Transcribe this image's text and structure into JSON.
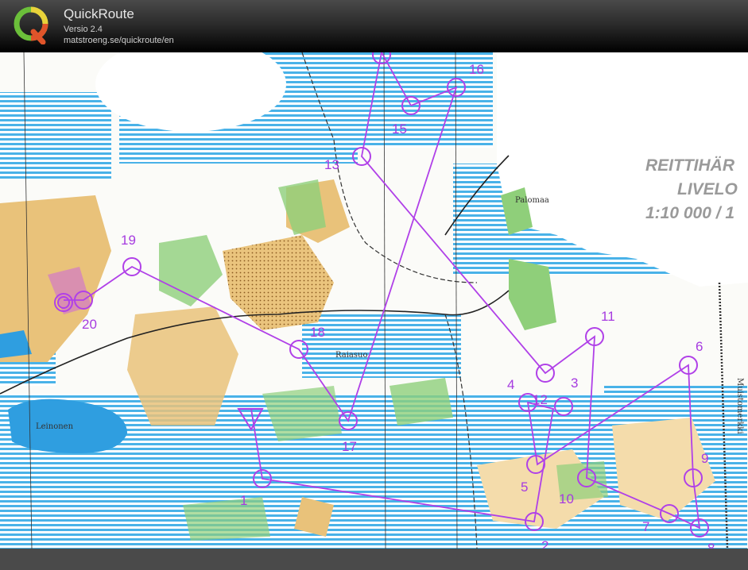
{
  "app": {
    "title": "QuickRoute",
    "version": "Versio 2.4",
    "url": "matstroeng.se/quickroute/en",
    "logo_letter": "Q"
  },
  "map": {
    "title_lines": [
      "REITTIHÄR",
      "LIVELO",
      "1:10 000 / 1"
    ],
    "place_names": [
      "Palomaa",
      "Raiasuo",
      "Leinonen",
      "Muistomerkki"
    ],
    "route_color": "#b040e8",
    "water_color": "#49b2e8",
    "field_color": "#e9c27a",
    "forest_color": "#8fcf7a"
  },
  "controls": [
    {
      "label": "1"
    },
    {
      "label": "2"
    },
    {
      "label": "3"
    },
    {
      "label": "4"
    },
    {
      "label": "5"
    },
    {
      "label": "6"
    },
    {
      "label": "7"
    },
    {
      "label": "8"
    },
    {
      "label": "9"
    },
    {
      "label": "10"
    },
    {
      "label": "11"
    },
    {
      "label": "12"
    },
    {
      "label": "13"
    },
    {
      "label": "15"
    },
    {
      "label": "16"
    },
    {
      "label": "17"
    },
    {
      "label": "18"
    },
    {
      "label": "19"
    },
    {
      "label": "20"
    }
  ]
}
